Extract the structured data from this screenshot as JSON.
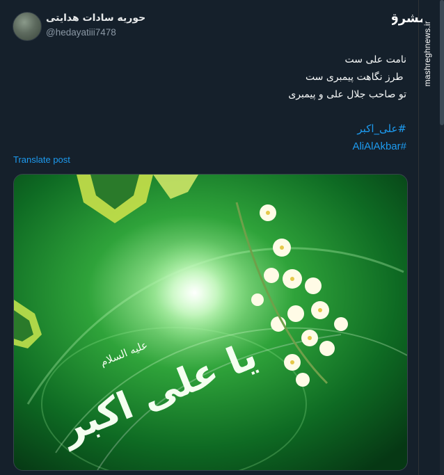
{
  "post": {
    "display_name": "حوریه سادات هدایتی",
    "handle": "@hedayatiii7478",
    "text_lines": [
      "نامت علی ست",
      " طرز نگاهت پیمبری ست",
      "تو صاحب جلال علی و پیمبری"
    ],
    "hashtags": [
      "#علی_اکبر",
      "#AliAlAkbar"
    ],
    "translate_label": "Translate post",
    "media_alt": "Green religious artwork with calligraphy"
  },
  "image_calligraphy": {
    "main": "یا علی اکبر",
    "sub": "علیه السلام"
  },
  "watermark": {
    "logo": "مشرق",
    "site": "mashreghnews.ir"
  },
  "colors": {
    "background": "#15202b",
    "link": "#1d9bf0",
    "text": "#f7f9f9",
    "muted": "#8b98a5"
  }
}
